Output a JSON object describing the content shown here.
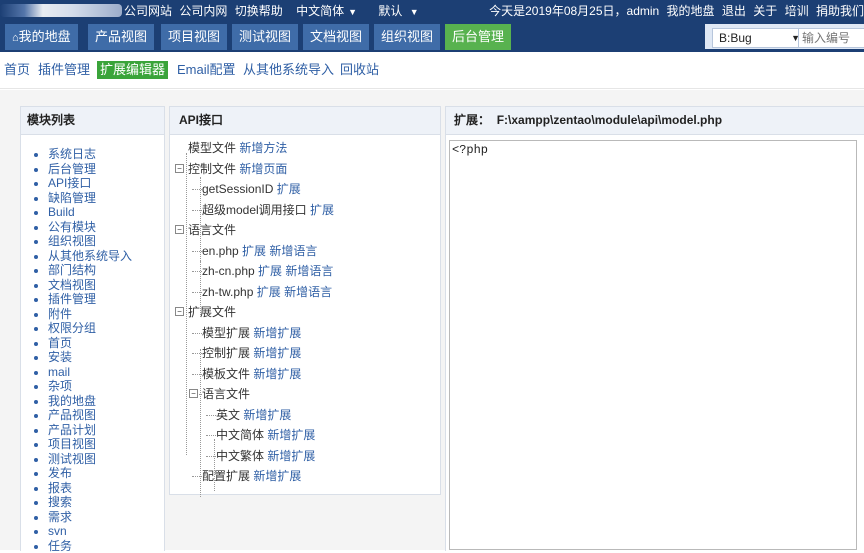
{
  "topbar": {
    "left_links": [
      "公司网站",
      "公司内网",
      "切换帮助"
    ],
    "lang": "中文简体",
    "theme": "默认",
    "right_text": "今天是2019年08月25日，admin",
    "right_links": [
      "我的地盘",
      "退出",
      "关于",
      "培训",
      "捐助我们"
    ]
  },
  "nav": {
    "tabs": [
      {
        "label": "我的地盘",
        "icon": "home-icon"
      },
      {
        "label": "产品视图"
      },
      {
        "label": "项目视图"
      },
      {
        "label": "测试视图"
      },
      {
        "label": "文档视图"
      },
      {
        "label": "组织视图"
      },
      {
        "label": "后台管理"
      }
    ],
    "active_tab": "后台管理",
    "search_select": "B:Bug",
    "search_placeholder": "输入编号"
  },
  "subnav": {
    "items": [
      "首页",
      "插件管理",
      "扩展编辑器",
      "Email配置",
      "从其他系统导入",
      "回收站"
    ],
    "active": "扩展编辑器"
  },
  "module_panel": {
    "title": "模块列表",
    "modules": [
      "系统日志",
      "后台管理",
      "API接口",
      "缺陷管理",
      "Build",
      "公有模块",
      "组织视图",
      "从其他系统导入",
      "部门结构",
      "文档视图",
      "插件管理",
      "附件",
      "权限分组",
      "首页",
      "安装",
      "mail",
      "杂项",
      "我的地盘",
      "产品视图",
      "产品计划",
      "项目视图",
      "测试视图",
      "发布",
      "报表",
      "搜索",
      "需求",
      "svn",
      "任务"
    ]
  },
  "api_panel": {
    "title": "API接口",
    "tree": [
      {
        "label": "模型文件",
        "link": "新增方法"
      },
      {
        "label": "控制文件",
        "link": "新增页面"
      },
      {
        "label": "getSessionID",
        "link": "扩展"
      },
      {
        "label": "超级model调用接口",
        "link": "扩展"
      },
      {
        "label": "语言文件",
        "link": ""
      },
      {
        "label": "en.php",
        "link": "扩展",
        "link2": "新增语言"
      },
      {
        "label": "zh-cn.php",
        "link": "扩展",
        "link2": "新增语言"
      },
      {
        "label": "zh-tw.php",
        "link": "扩展",
        "link2": "新增语言"
      },
      {
        "label": "扩展文件",
        "link": ""
      },
      {
        "label": "模型扩展",
        "link": "新增扩展"
      },
      {
        "label": "控制扩展",
        "link": "新增扩展"
      },
      {
        "label": "模板文件",
        "link": "新增扩展"
      },
      {
        "label": "语言文件",
        "link": ""
      },
      {
        "label": "英文",
        "link": "新增扩展"
      },
      {
        "label": "中文简体",
        "link": "新增扩展"
      },
      {
        "label": "中文繁体",
        "link": "新增扩展"
      },
      {
        "label": "配置扩展",
        "link": "新增扩展"
      }
    ]
  },
  "editor_panel": {
    "title_label": "扩展：",
    "path": "F:\\xampp\\zentao\\module\\api\\model.php",
    "content": "<?php"
  }
}
